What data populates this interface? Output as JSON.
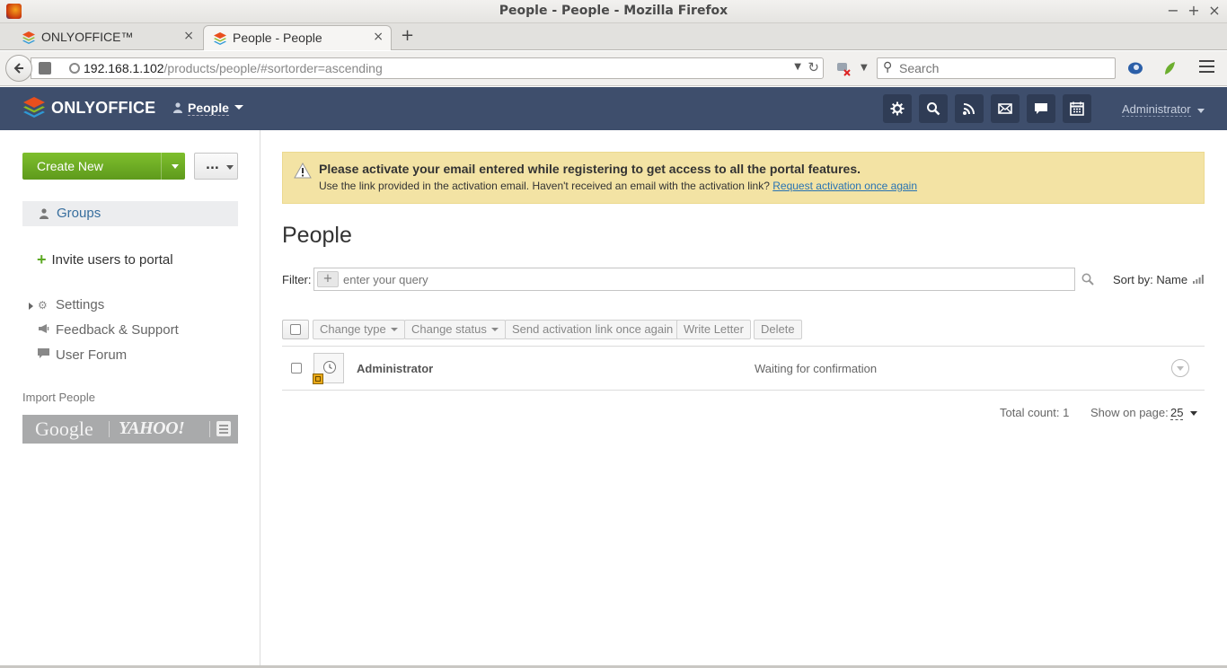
{
  "window": {
    "title": "People - People - Mozilla Firefox",
    "controls": [
      "−",
      "+",
      "×"
    ]
  },
  "tabs": [
    {
      "label": "ONLYOFFICE™",
      "active": false
    },
    {
      "label": "People - People",
      "active": true
    }
  ],
  "tab_close": "×",
  "new_tab": "+",
  "navbar": {
    "url_host": "192.168.1.102",
    "url_path": "/products/people/#sortorder=ascending",
    "search_placeholder": "Search"
  },
  "header": {
    "brand": "ONLYOFFICE",
    "module": "People",
    "user": "Administrator",
    "icons": [
      "settings-icon",
      "search-icon",
      "feed-icon",
      "mail-icon",
      "chat-icon",
      "calendar-icon"
    ],
    "bg_color": "#3e4e6c"
  },
  "sidebar": {
    "create_new": "Create New",
    "more": "...",
    "groups": "Groups",
    "invite": "Invite users to portal",
    "links": [
      {
        "label": "Settings",
        "icon": "gear-icon"
      },
      {
        "label": "Feedback & Support",
        "icon": "megaphone-icon"
      },
      {
        "label": "User Forum",
        "icon": "speech-bubble-icon"
      }
    ],
    "import_title": "Import People",
    "import_sources": [
      "Google",
      "YAHOO!"
    ]
  },
  "alert": {
    "title": "Please activate your email entered while registering to get access to all the portal features.",
    "body": "Use the link provided in the activation email. Haven't received an email with the activation link?",
    "link": "Request activation once again"
  },
  "main": {
    "title": "People",
    "filter_label": "Filter:",
    "filter_placeholder": "enter your query",
    "sort_by": "Sort by: Name",
    "actions": [
      "Change type",
      "Change status",
      "Send activation link once again",
      "Write Letter",
      "Delete"
    ],
    "rows": [
      {
        "name": "Administrator",
        "status": "Waiting for confirmation"
      }
    ],
    "total_count_label": "Total count:",
    "total_count": "1",
    "show_on_page_label": "Show on page:",
    "show_on_page": "25"
  }
}
